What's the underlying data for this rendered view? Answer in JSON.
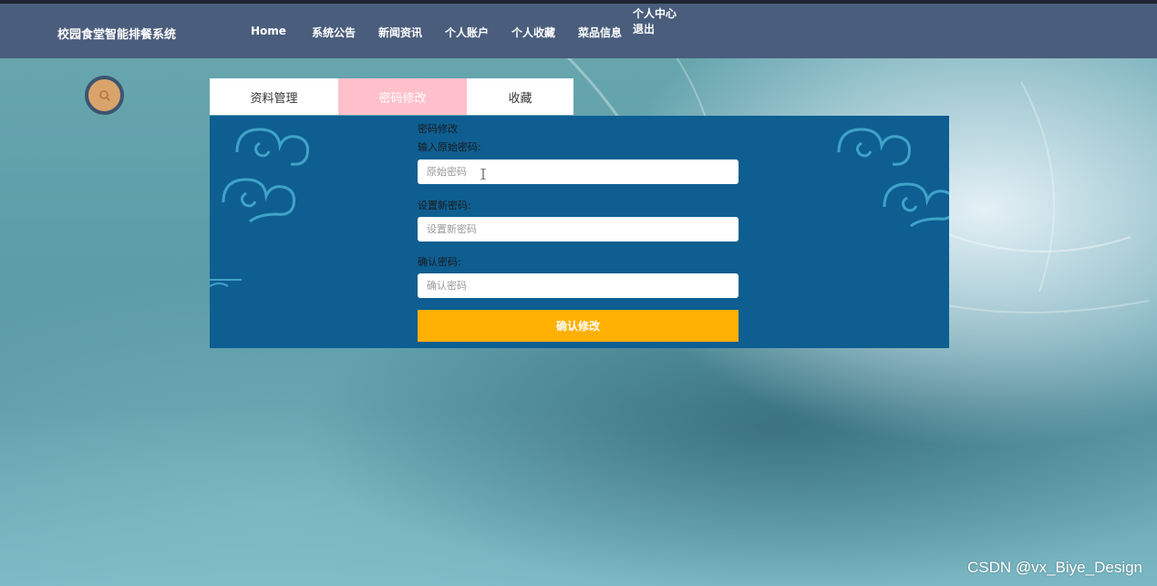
{
  "app": {
    "brand": "校园食堂智能排餐系统"
  },
  "nav": {
    "items": [
      {
        "label": "Home"
      },
      {
        "label": "系统公告"
      },
      {
        "label": "新闻资讯"
      },
      {
        "label": "个人账户"
      },
      {
        "label": "个人收藏"
      },
      {
        "label": "菜品信息"
      }
    ],
    "user_center": "个人中心",
    "logout": "退出"
  },
  "search": {
    "icon": "search-icon"
  },
  "tabs": [
    {
      "label": "资料管理",
      "active": false
    },
    {
      "label": "密码修改",
      "active": true
    },
    {
      "label": "收藏",
      "active": false
    }
  ],
  "form": {
    "title": "密码修改",
    "old_label": "输入原始密码:",
    "old_placeholder": "原始密码",
    "new_label": "设置新密码:",
    "new_placeholder": "设置新密码",
    "confirm_label": "确认密码:",
    "confirm_placeholder": "确认密码",
    "submit_label": "确认修改"
  },
  "colors": {
    "navbar": "#4a5d7c",
    "panel": "#0e5e92",
    "active_tab": "#ffc0cb",
    "submit": "#ffb000",
    "search_btn": "#d9a46b"
  },
  "watermark": "CSDN @vx_Biye_Design"
}
